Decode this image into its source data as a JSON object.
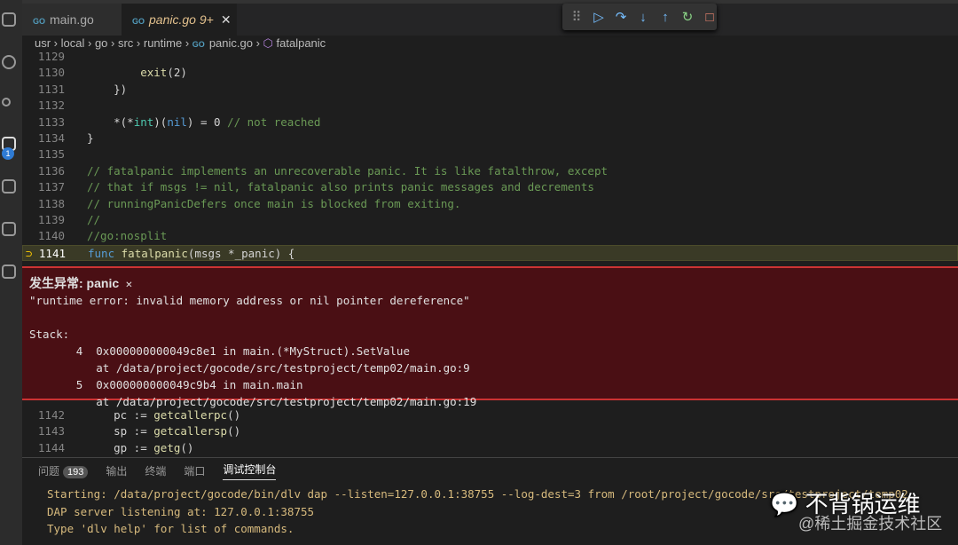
{
  "tabs": [
    {
      "label": "main.go",
      "icon": "go-file-icon"
    },
    {
      "label": "panic.go",
      "badge": "9+",
      "icon": "go-file-icon"
    }
  ],
  "breadcrumb": [
    "usr",
    "local",
    "go",
    "src",
    "runtime",
    "panic.go",
    "fatalpanic"
  ],
  "debug_toolbar": [
    "continue",
    "step-over",
    "step-into",
    "step-out",
    "restart",
    "stop"
  ],
  "code_top": [
    {
      "n": "1129",
      "t": ""
    },
    {
      "n": "1130",
      "t": "exit(2)"
    },
    {
      "n": "1131",
      "t": "})"
    },
    {
      "n": "1132",
      "t": ""
    },
    {
      "n": "1133",
      "t": "*(*int)(nil) = 0 // not reached"
    },
    {
      "n": "1134",
      "t": "}"
    },
    {
      "n": "1135",
      "t": ""
    },
    {
      "n": "1136",
      "t": "// fatalpanic implements an unrecoverable panic. It is like fatalthrow, except"
    },
    {
      "n": "1137",
      "t": "// that if msgs != nil, fatalpanic also prints panic messages and decrements"
    },
    {
      "n": "1138",
      "t": "// runningPanicDefers once main is blocked from exiting."
    },
    {
      "n": "1139",
      "t": "//"
    },
    {
      "n": "1140",
      "t": "//go:nosplit"
    },
    {
      "n": "1141",
      "t": "func fatalpanic(msgs *_panic) {"
    }
  ],
  "exception": {
    "title": "发生异常: panic",
    "message": "\"runtime error: invalid memory address or nil pointer dereference\"",
    "stack_label": "Stack:",
    "frames": [
      {
        "idx": "4",
        "addr": "0x000000000049c8e1 in main.(*MyStruct).SetValue",
        "loc": "at /data/project/gocode/src/testproject/temp02/main.go:9"
      },
      {
        "idx": "5",
        "addr": "0x000000000049c9b4 in main.main",
        "loc": "at /data/project/gocode/src/testproject/temp02/main.go:19"
      }
    ]
  },
  "code_bottom": [
    {
      "n": "1142",
      "t": "pc := getcallerpc()"
    },
    {
      "n": "1143",
      "t": "sp := getcallersp()"
    },
    {
      "n": "1144",
      "t": "gp := getg()"
    }
  ],
  "panel": {
    "tabs": [
      "问题",
      "输出",
      "终端",
      "端口",
      "调试控制台"
    ],
    "problems_count": "193",
    "lines": [
      "Starting: /data/project/gocode/bin/dlv dap --listen=127.0.0.1:38755 --log-dest=3 from /root/project/gocode/src/testproject/temp02",
      "DAP server listening at: 127.0.0.1:38755",
      "Type 'dlv help' for list of commands."
    ]
  },
  "watermark": {
    "line1": "不背锅运维",
    "line2": "@稀土掘金技术社区"
  }
}
